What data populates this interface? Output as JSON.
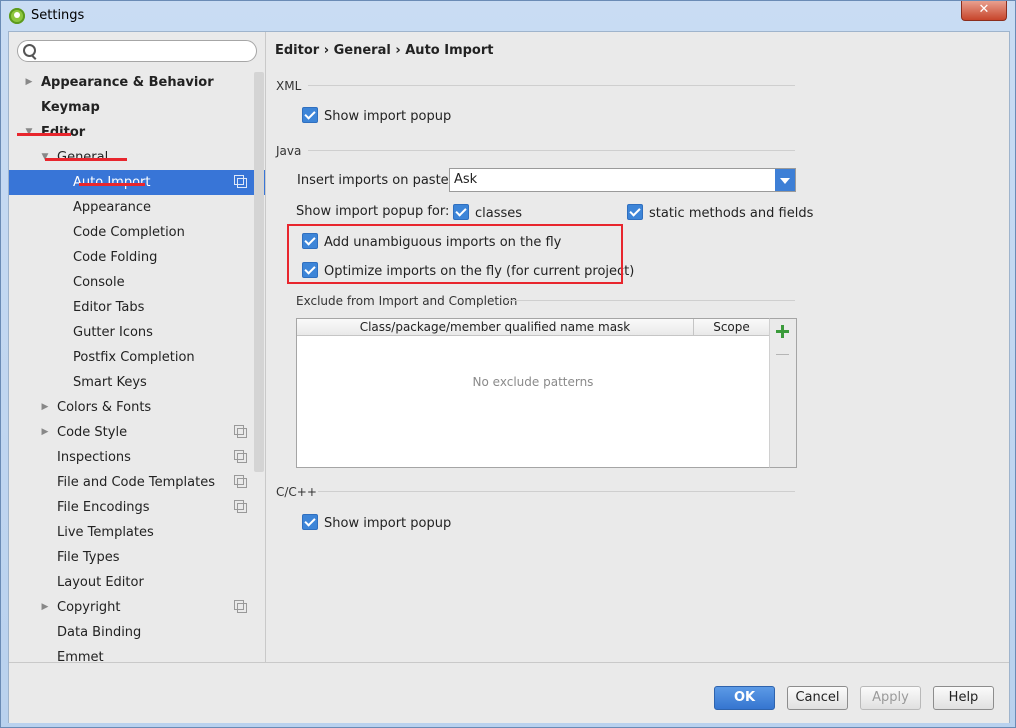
{
  "window": {
    "title": "Settings",
    "close_label": "✕"
  },
  "search": {
    "placeholder": "",
    "value": ""
  },
  "sidebar": {
    "items": [
      {
        "label": "Appearance & Behavior",
        "level": 0,
        "arrow": "▶",
        "bold": true
      },
      {
        "label": "Keymap",
        "level": 0,
        "arrow": "",
        "bold": true
      },
      {
        "label": "Editor",
        "level": 0,
        "arrow": "▼",
        "bold": true
      },
      {
        "label": "General",
        "level": 1,
        "arrow": "▼"
      },
      {
        "label": "Auto Import",
        "level": 2,
        "selected": true,
        "copy": true
      },
      {
        "label": "Appearance",
        "level": 2
      },
      {
        "label": "Code Completion",
        "level": 2
      },
      {
        "label": "Code Folding",
        "level": 2
      },
      {
        "label": "Console",
        "level": 2
      },
      {
        "label": "Editor Tabs",
        "level": 2
      },
      {
        "label": "Gutter Icons",
        "level": 2
      },
      {
        "label": "Postfix Completion",
        "level": 2
      },
      {
        "label": "Smart Keys",
        "level": 2
      },
      {
        "label": "Colors & Fonts",
        "level": 1,
        "arrow": "▶"
      },
      {
        "label": "Code Style",
        "level": 1,
        "arrow": "▶",
        "copy": true
      },
      {
        "label": "Inspections",
        "level": 1,
        "copy": true
      },
      {
        "label": "File and Code Templates",
        "level": 1,
        "copy": true
      },
      {
        "label": "File Encodings",
        "level": 1,
        "copy": true
      },
      {
        "label": "Live Templates",
        "level": 1
      },
      {
        "label": "File Types",
        "level": 1
      },
      {
        "label": "Layout Editor",
        "level": 1
      },
      {
        "label": "Copyright",
        "level": 1,
        "arrow": "▶",
        "copy": true
      },
      {
        "label": "Data Binding",
        "level": 1
      },
      {
        "label": "Emmet",
        "level": 1
      }
    ]
  },
  "breadcrumb": {
    "part1": "Editor",
    "sep": "›",
    "part2": "General",
    "part3": "Auto Import"
  },
  "xml": {
    "section": "XML",
    "show_popup": "Show import popup"
  },
  "java": {
    "section": "Java",
    "insert_label": "Insert imports on paste:",
    "insert_value": "Ask",
    "show_popup_for": "Show import popup for:",
    "classes": "classes",
    "static": "static methods and fields",
    "unambiguous": "Add unambiguous imports on the fly",
    "optimize": "Optimize imports on the fly (for current project)",
    "exclude_title": "Exclude from Import and Completion",
    "col_mask": "Class/package/member qualified name mask",
    "col_scope": "Scope",
    "empty": "No exclude patterns"
  },
  "cpp": {
    "section": "C/C++",
    "show_popup": "Show import popup"
  },
  "footer": {
    "ok": "OK",
    "cancel": "Cancel",
    "apply": "Apply",
    "help": "Help"
  },
  "colors": {
    "accent": "#3875d7",
    "highlight": "#e8262d",
    "add": "#3a9a3a"
  }
}
